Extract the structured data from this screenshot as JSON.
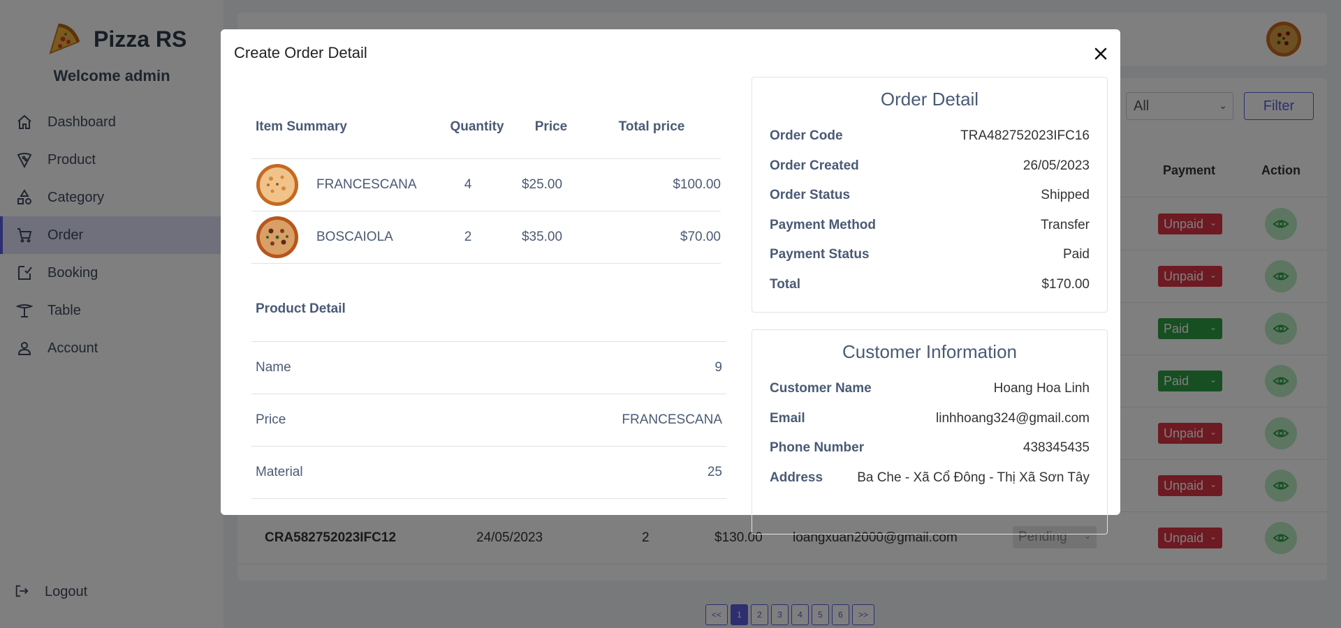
{
  "sidebar": {
    "brand": "Pizza RS",
    "welcome": "Welcome admin",
    "items": [
      {
        "label": "Dashboard",
        "icon": "home-icon"
      },
      {
        "label": "Product",
        "icon": "pizza-slice-icon"
      },
      {
        "label": "Category",
        "icon": "category-shapes-icon"
      },
      {
        "label": "Order",
        "icon": "cart-icon",
        "active": true
      },
      {
        "label": "Booking",
        "icon": "booking-icon"
      },
      {
        "label": "Table",
        "icon": "table-icon"
      },
      {
        "label": "Account",
        "icon": "user-icon"
      }
    ],
    "logout": "Logout"
  },
  "filter": {
    "select_value": "All",
    "button": "Filter"
  },
  "orders_table": {
    "headers": {
      "payment": "Payment",
      "action": "Action"
    },
    "payment_badges": [
      "Unpaid",
      "Unpaid",
      "Paid",
      "Paid",
      "Unpaid",
      "Unpaid",
      "Unpaid"
    ],
    "last_row": {
      "code": "CRA582752023IFC12",
      "date": "24/05/2023",
      "quantity": "2",
      "total": "$130.00",
      "email": "loangxuan2000@gmail.com",
      "status": "Pending",
      "payment": "Unpaid"
    }
  },
  "pagination": [
    "<<",
    "1",
    "2",
    "3",
    "4",
    "5",
    "6",
    ">>"
  ],
  "modal": {
    "title": "Create Order Detail",
    "items_table": {
      "headers": [
        "Item Summary",
        "Quantity",
        "Price",
        "Total price"
      ],
      "rows": [
        {
          "name": "FRANCESCANA",
          "quantity": "4",
          "price": "$25.00",
          "total": "$100.00"
        },
        {
          "name": "BOSCAIOLA",
          "quantity": "2",
          "price": "$35.00",
          "total": "$70.00"
        }
      ]
    },
    "product_detail": {
      "title": "Product Detail",
      "rows": [
        {
          "label": "Name",
          "value": "9"
        },
        {
          "label": "Price",
          "value": "FRANCESCANA"
        },
        {
          "label": "Material",
          "value": "25"
        }
      ]
    },
    "order_detail": {
      "title": "Order Detail",
      "rows": [
        {
          "label": "Order Code",
          "value": "TRA482752023IFC16"
        },
        {
          "label": "Order Created",
          "value": "26/05/2023"
        },
        {
          "label": "Order Status",
          "value": "Shipped"
        },
        {
          "label": "Payment Method",
          "value": "Transfer"
        },
        {
          "label": "Payment Status",
          "value": "Paid"
        },
        {
          "label": "Total",
          "value": "$170.00"
        }
      ]
    },
    "customer_info": {
      "title": "Customer Information",
      "rows": [
        {
          "label": "Customer Name",
          "value": "Hoang Hoa Linh"
        },
        {
          "label": "Email",
          "value": "linhhoang324@gmail.com"
        },
        {
          "label": "Phone Number",
          "value": "438345435"
        },
        {
          "label": "Address",
          "value": "Ba Che - Xã Cổ Đông - Thị Xã Sơn Tây"
        }
      ]
    }
  },
  "colors": {
    "accent": "#5b5fe0",
    "unpaid": "#dc3545",
    "paid": "#2f9e44",
    "overlay": "rgba(0,0,0,0.5)"
  }
}
